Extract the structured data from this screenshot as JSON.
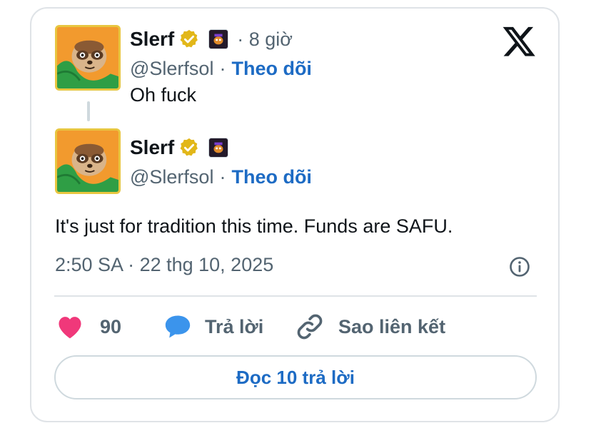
{
  "tweets": [
    {
      "name": "Slerf",
      "handle": "@Slerfsol",
      "time": "· 8 giờ",
      "separator": "·",
      "follow_label": "Theo dõi",
      "text": "Oh fuck"
    },
    {
      "name": "Slerf",
      "handle": "@Slerfsol",
      "separator": "·",
      "follow_label": "Theo dõi",
      "text": "It's just for tradition this time. Funds are SAFU."
    }
  ],
  "timestamp": "2:50 SA · 22 thg 10, 2025",
  "actions": {
    "like_count": "90",
    "reply_label": "Trả lời",
    "copy_link_label": "Sao liên kết"
  },
  "read_replies_label": "Đọc 10 trả lời",
  "colors": {
    "accent": "#1d6bc4",
    "like": "#f0387a",
    "reply": "#3b94ec",
    "verified": "#e2b719"
  },
  "icons": [
    "verified-badge-icon",
    "affiliate-badge-icon",
    "x-logo-icon",
    "info-icon",
    "heart-icon",
    "reply-bubble-icon",
    "link-icon"
  ]
}
